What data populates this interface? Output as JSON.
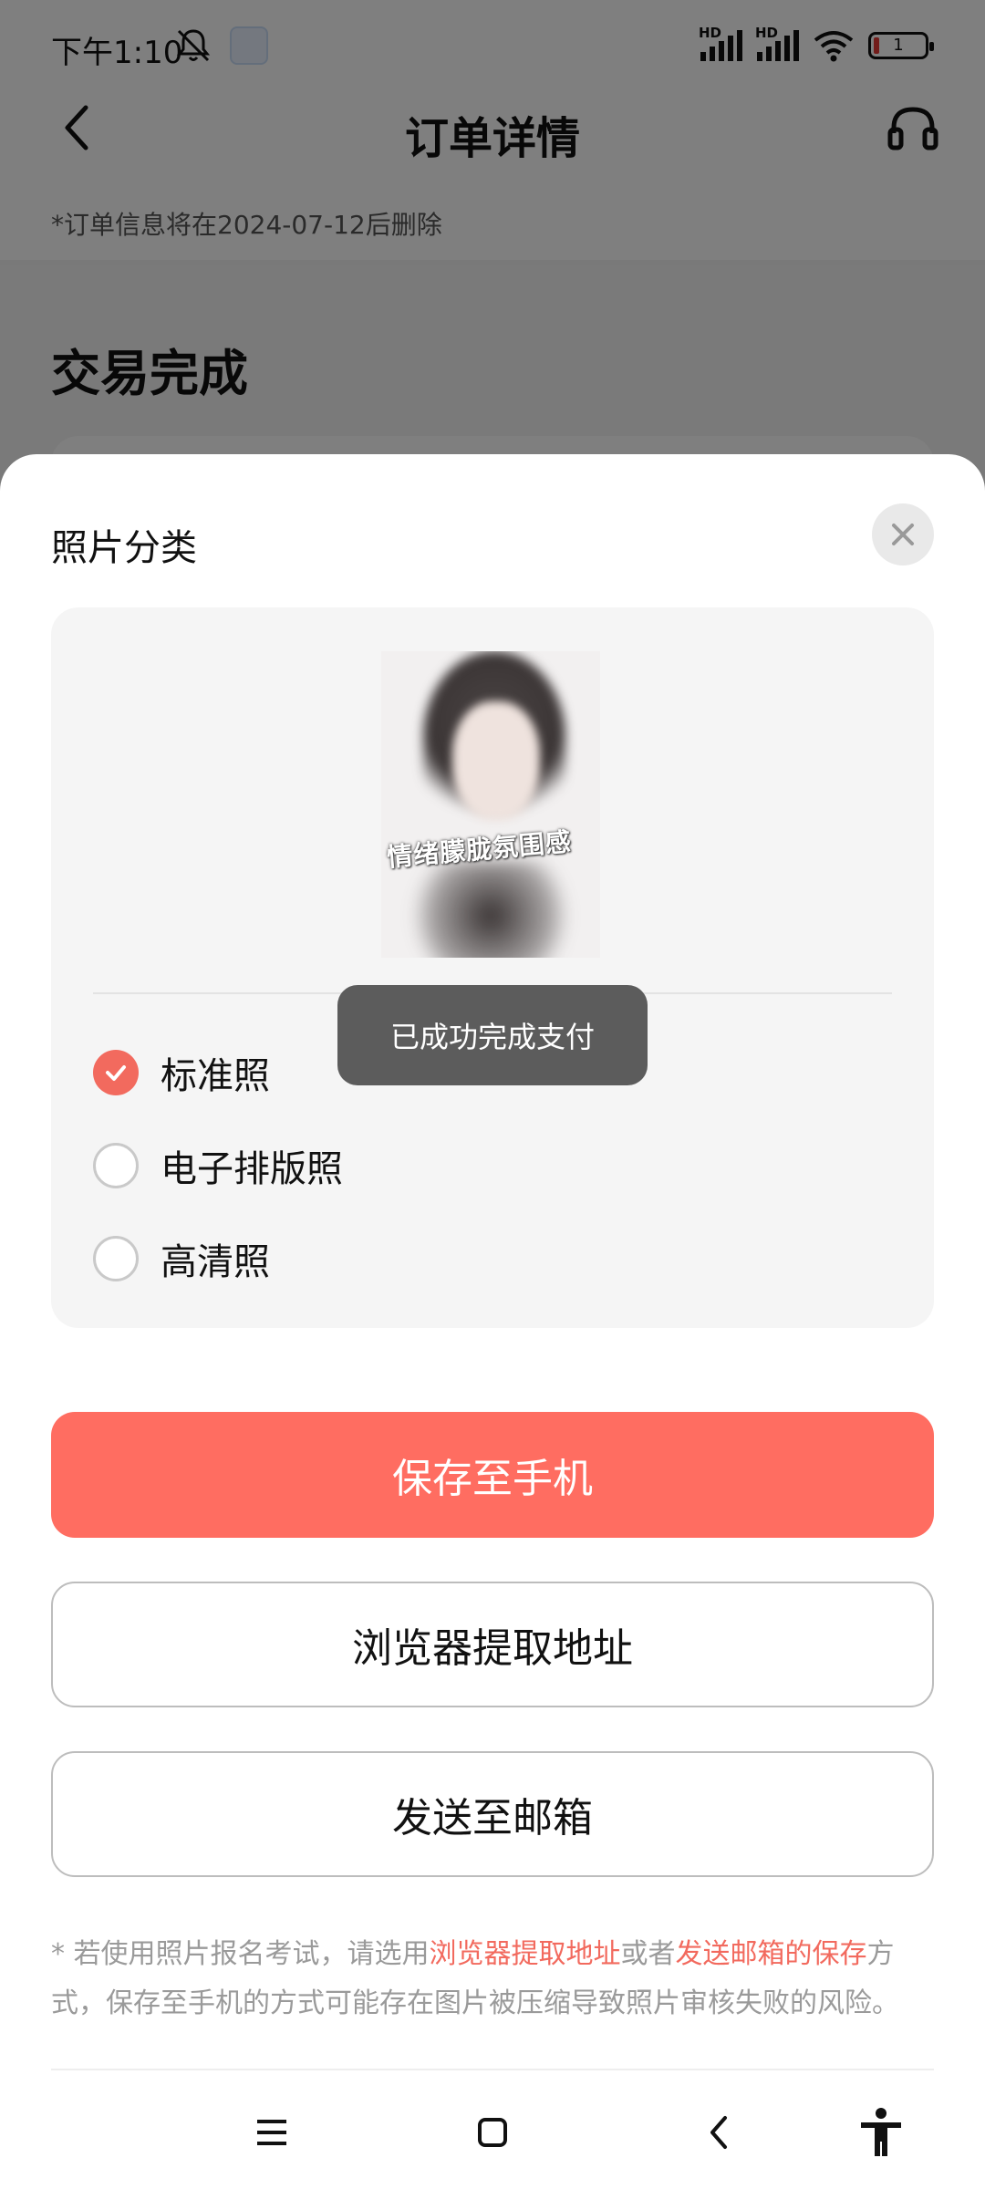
{
  "status_bar": {
    "time": "下午1:10",
    "battery_level": "1"
  },
  "header": {
    "title": "订单详情",
    "notice": "*订单信息将在2024-07-12后删除"
  },
  "order": {
    "status": "交易完成"
  },
  "sheet": {
    "title": "照片分类",
    "photo_caption": "情绪朦胧氛围感",
    "options": [
      {
        "label": "标准照",
        "checked": true
      },
      {
        "label": "电子排版照",
        "checked": false
      },
      {
        "label": "高清照",
        "checked": false
      }
    ],
    "buttons": {
      "save": "保存至手机",
      "browser": "浏览器提取地址",
      "email": "发送至邮箱"
    },
    "footnote": {
      "part1": "* 若使用照片报名考试，请选用",
      "link1": "浏览器提取地址",
      "part2": "或者",
      "link2": "发送邮箱的保存",
      "part3": "方式，保存至手机的方式可能存在图片被压缩导致照片审核失败的风险。"
    }
  },
  "toast": {
    "text": "已成功完成支付"
  },
  "colors": {
    "accent": "#ff6d61",
    "check": "#f26a5e"
  },
  "icons": [
    "mute-icon",
    "app-icon",
    "signal-icon",
    "wifi-icon",
    "battery-icon",
    "back-icon",
    "headset-icon",
    "close-icon",
    "check-icon",
    "menu-icon",
    "home-icon",
    "back-nav-icon",
    "accessibility-icon"
  ]
}
